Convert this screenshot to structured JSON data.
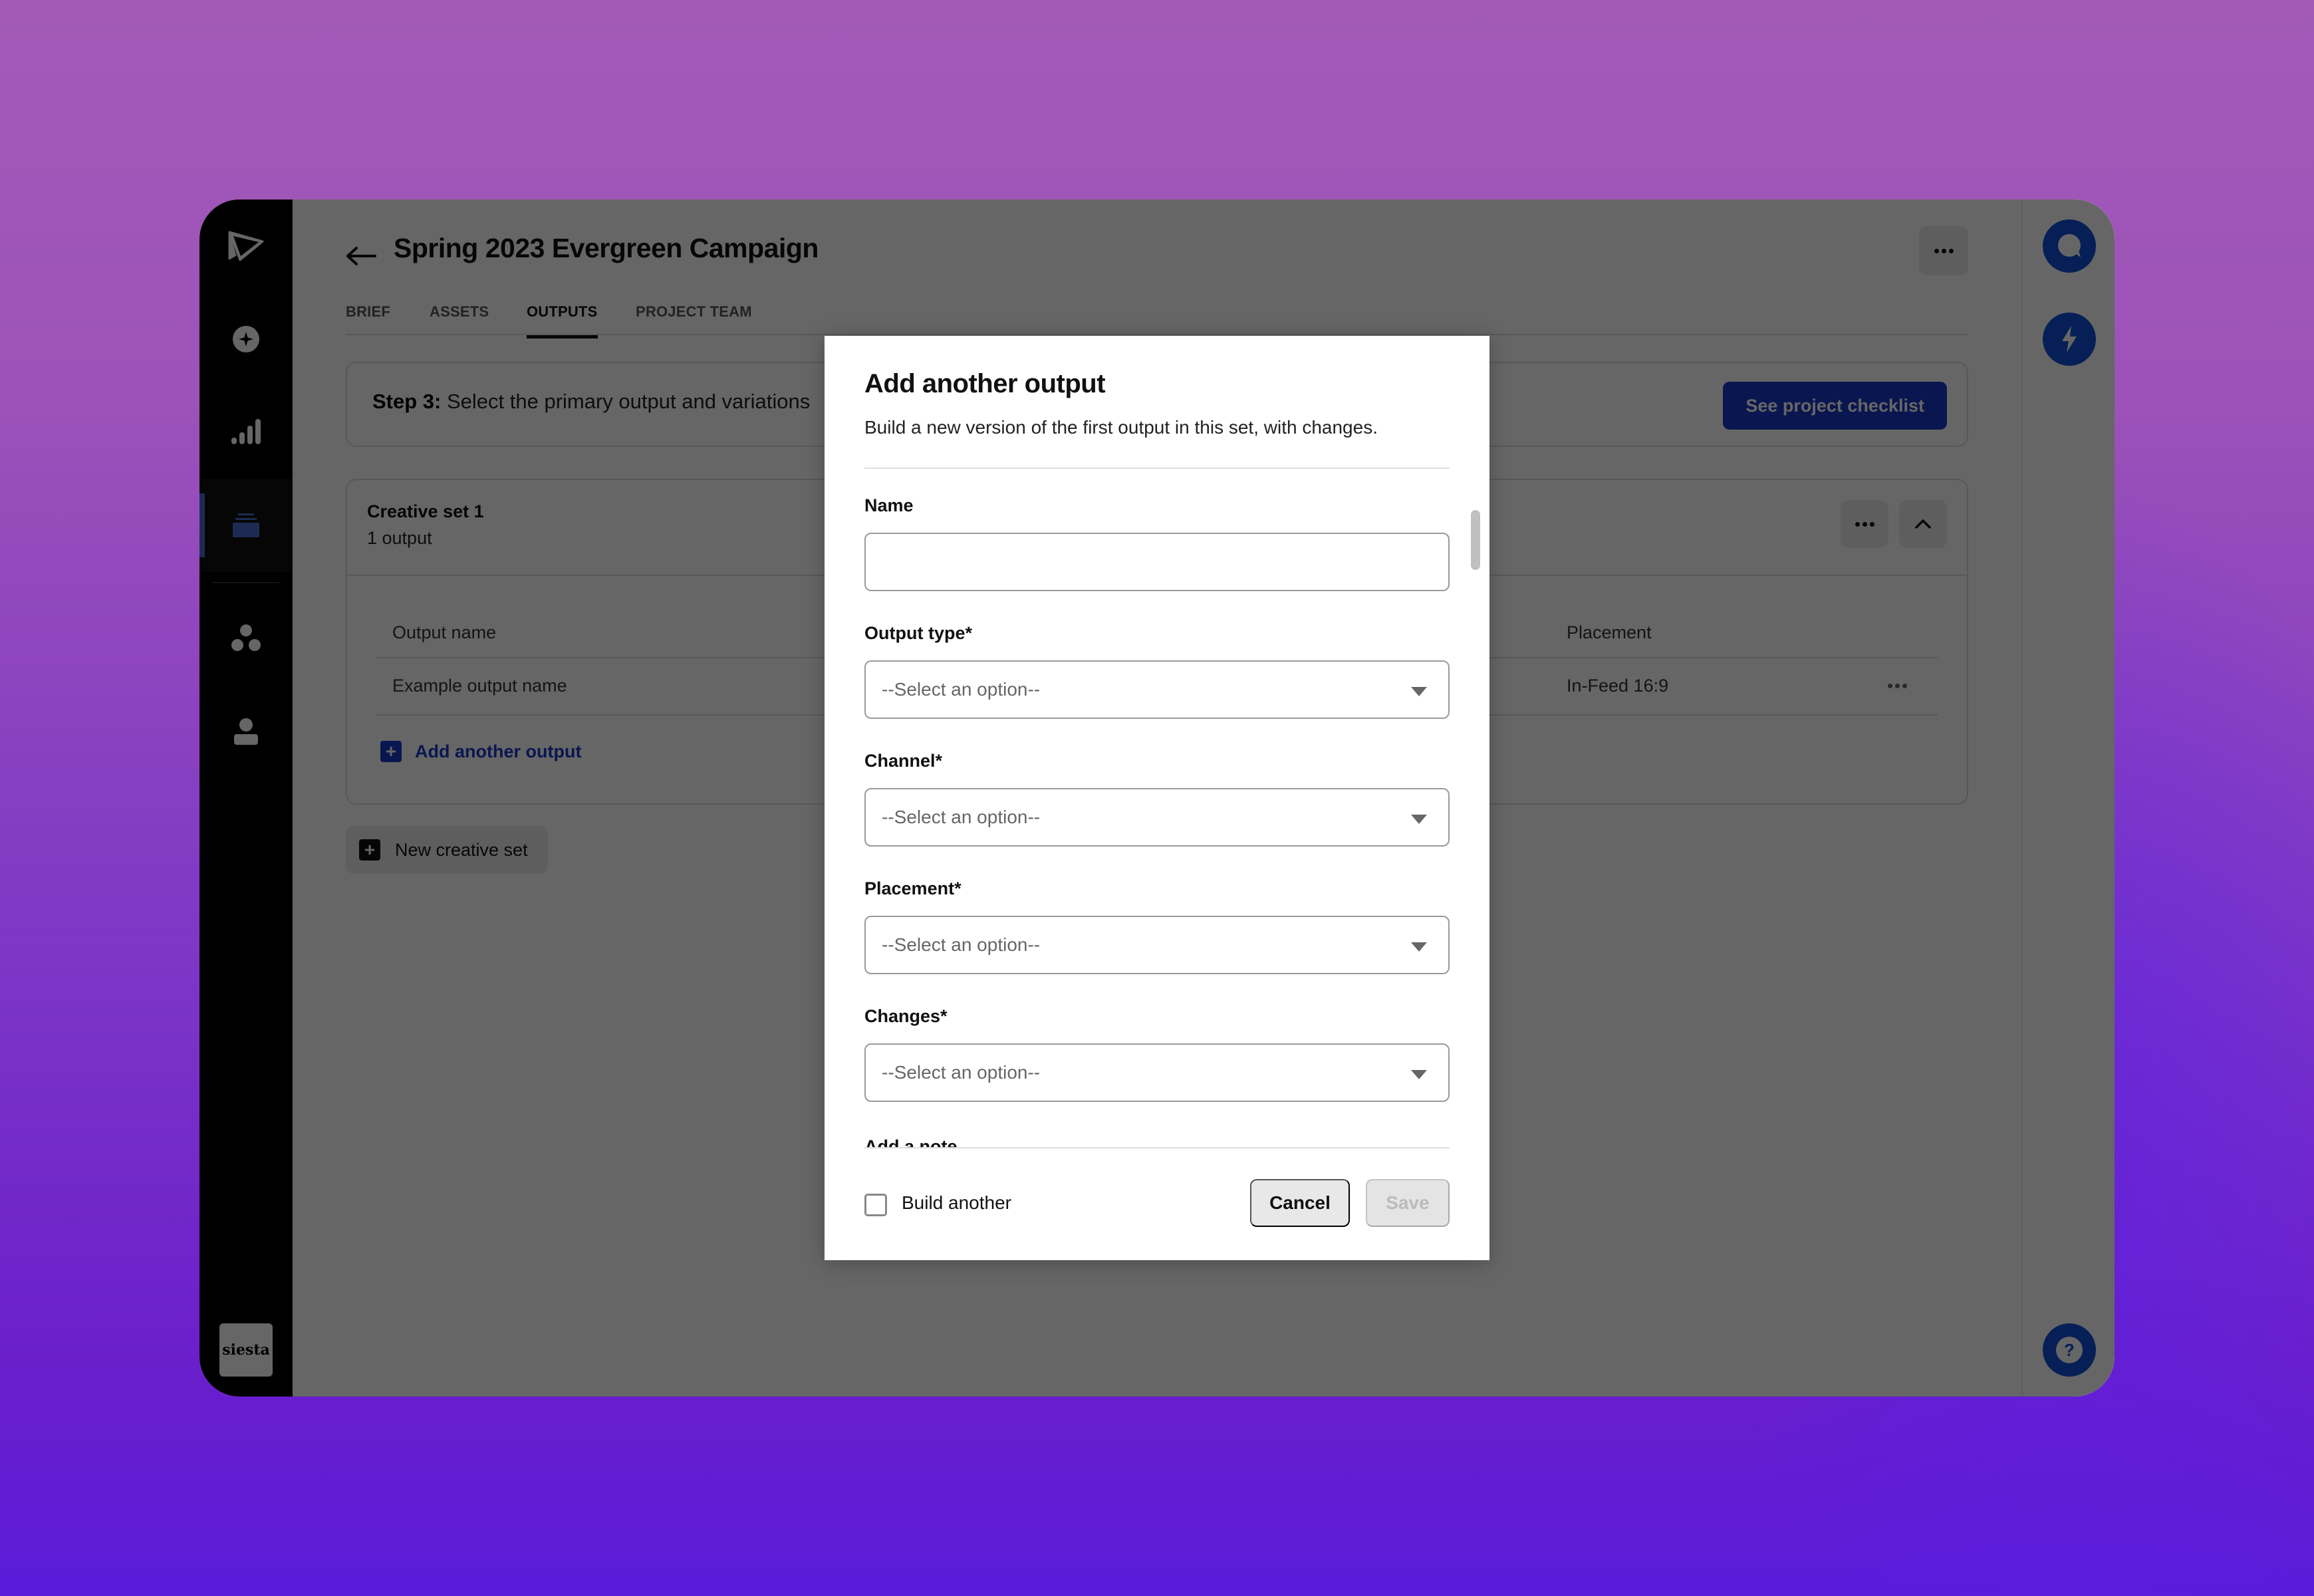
{
  "sidebar": {
    "items": [
      {
        "icon": "send-logo-icon",
        "label": "Home"
      },
      {
        "icon": "sparkle-icon",
        "label": "Discover"
      },
      {
        "icon": "signal-bars-icon",
        "label": "Analytics"
      },
      {
        "icon": "stack-icon",
        "label": "Projects",
        "active": true
      },
      {
        "icon": "group-icon",
        "label": "Teams"
      },
      {
        "icon": "person-icon",
        "label": "Profile"
      }
    ],
    "brand": "siesta"
  },
  "header": {
    "title": "Spring 2023 Evergreen Campaign",
    "back_icon": "arrow-left-icon",
    "more_icon": "ellipsis-icon"
  },
  "tabs": [
    {
      "label": "BRIEF",
      "active": false
    },
    {
      "label": "ASSETS",
      "active": false
    },
    {
      "label": "OUTPUTS",
      "active": true
    },
    {
      "label": "PROJECT TEAM",
      "active": false
    }
  ],
  "step": {
    "prefix": "Step 3:",
    "text": "Select the primary output and variations",
    "checklist_button": "See project checklist"
  },
  "creative_set": {
    "title": "Creative set 1",
    "subtitle": "1 output",
    "columns": [
      "Output name",
      "Placement"
    ],
    "rows": [
      {
        "output_name": "Example output name",
        "placement": "In-Feed 16:9"
      }
    ],
    "add_output_label": "Add another output"
  },
  "new_set_label": "New creative set",
  "right_rail": {
    "buttons": [
      "chat-icon",
      "lightning-icon",
      "help-icon"
    ]
  },
  "modal": {
    "title": "Add another output",
    "description": "Build a new version of the first output in this set, with changes.",
    "fields": {
      "name": {
        "label": "Name",
        "value": "",
        "placeholder": ""
      },
      "output_type": {
        "label": "Output type*",
        "value": "--Select an option--"
      },
      "channel": {
        "label": "Channel*",
        "value": "--Select an option--"
      },
      "placement": {
        "label": "Placement*",
        "value": "--Select an option--"
      },
      "changes": {
        "label": "Changes*",
        "value": "--Select an option--"
      },
      "note": {
        "label": "Add a note"
      }
    },
    "build_another": {
      "label": "Build another",
      "checked": false
    },
    "cancel_label": "Cancel",
    "save_label": "Save",
    "save_disabled": true
  },
  "colors": {
    "accent": "#1939c8",
    "rail_button": "#0f4fd6",
    "overlay": "rgba(0,0,0,0.6)"
  }
}
